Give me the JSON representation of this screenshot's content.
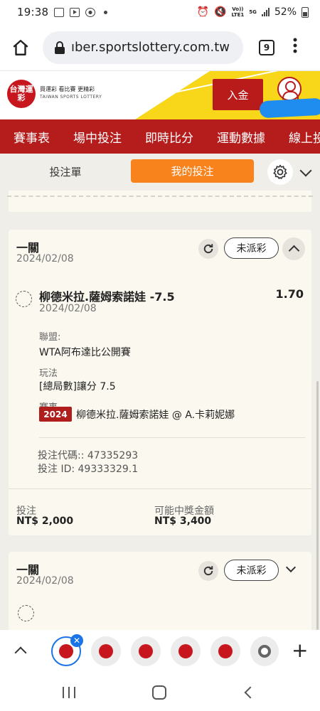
{
  "status_bar": {
    "time": "19:38",
    "battery": "52%",
    "network_top": "Vo))",
    "network_bottom": "LTE1",
    "gen": "5G"
  },
  "browser": {
    "url": "ıber.sportslottery.com.tw",
    "tab_count": "9"
  },
  "header": {
    "logo_text": "台灣運彩",
    "tagline": "買運彩 看比賽 更精彩",
    "tagline_en": "TAIWAN SPORTS LOTTERY",
    "deposit_label": "入金",
    "brand_color": "#b51d1d",
    "accent_color": "#f8d61a"
  },
  "nav": {
    "items": [
      "賽事表",
      "場中投注",
      "即時比分",
      "運動數據",
      "線上投"
    ]
  },
  "toolbar": {
    "bet_slip_label": "投注單",
    "my_bets_label": "我的投注",
    "active_color": "#f8821c"
  },
  "bets": [
    {
      "type": "一關",
      "date": "2024/02/08",
      "status": "未派彩",
      "selection": "柳德米拉.薩姆索諾娃 -7.5",
      "odds": "1.70",
      "selection_date": "2024/02/08",
      "league_label": "聯盟:",
      "league": "WTA阿布達比公開賽",
      "market_label": "玩法",
      "market": "[總局數]讓分 7.5",
      "event_label": "賽事",
      "event_year": "2024",
      "event": "柳德米拉.薩姆索諾娃 @ A.卡莉妮娜",
      "bet_code": "投注代碼:: 47335293",
      "bet_id": "投注 ID: 49333329.1",
      "stake_label": "投注",
      "stake": "NT$ 2,000",
      "payout_label": "可能中獎金額",
      "payout": "NT$ 3,400"
    },
    {
      "type": "一關",
      "date": "2024/02/08",
      "status": "未派彩"
    }
  ],
  "tab_strip": {
    "close_symbol": "✕",
    "new_tab_symbol": "+"
  }
}
